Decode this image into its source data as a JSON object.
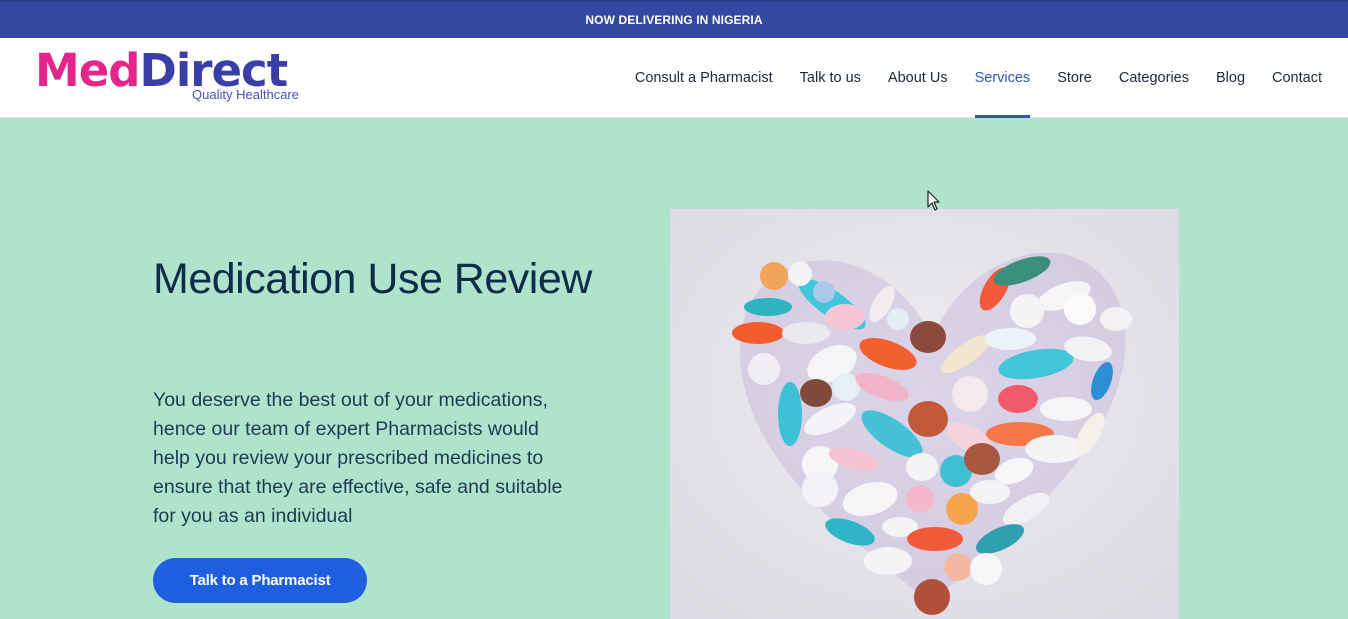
{
  "topbar": {
    "text": "NOW DELIVERING IN NIGERIA"
  },
  "logo": {
    "part1": "Med",
    "part2": "Direct",
    "tagline": "Quality Healthcare"
  },
  "nav": {
    "items": [
      {
        "label": "Consult a Pharmacist"
      },
      {
        "label": "Talk to us"
      },
      {
        "label": "About Us"
      },
      {
        "label": "Services"
      },
      {
        "label": "Store"
      },
      {
        "label": "Categories"
      },
      {
        "label": "Blog"
      },
      {
        "label": "Contact"
      }
    ],
    "active": "Services"
  },
  "hero": {
    "title": "Medication Use Review",
    "text": "You deserve the best out of your medications, hence our team of expert Pharmacists would help you review your prescribed medicines to ensure that they are effective, safe and suitable for you as an individual",
    "cta_label": "Talk to a Pharmacist"
  },
  "colors": {
    "topbar": "#3348a0",
    "hero_bg": "#b0e3cc",
    "accent": "#2e55b8",
    "cta": "#1e5fe0",
    "logo_pink": "#e4268a",
    "logo_blue": "#3a3fa8"
  }
}
